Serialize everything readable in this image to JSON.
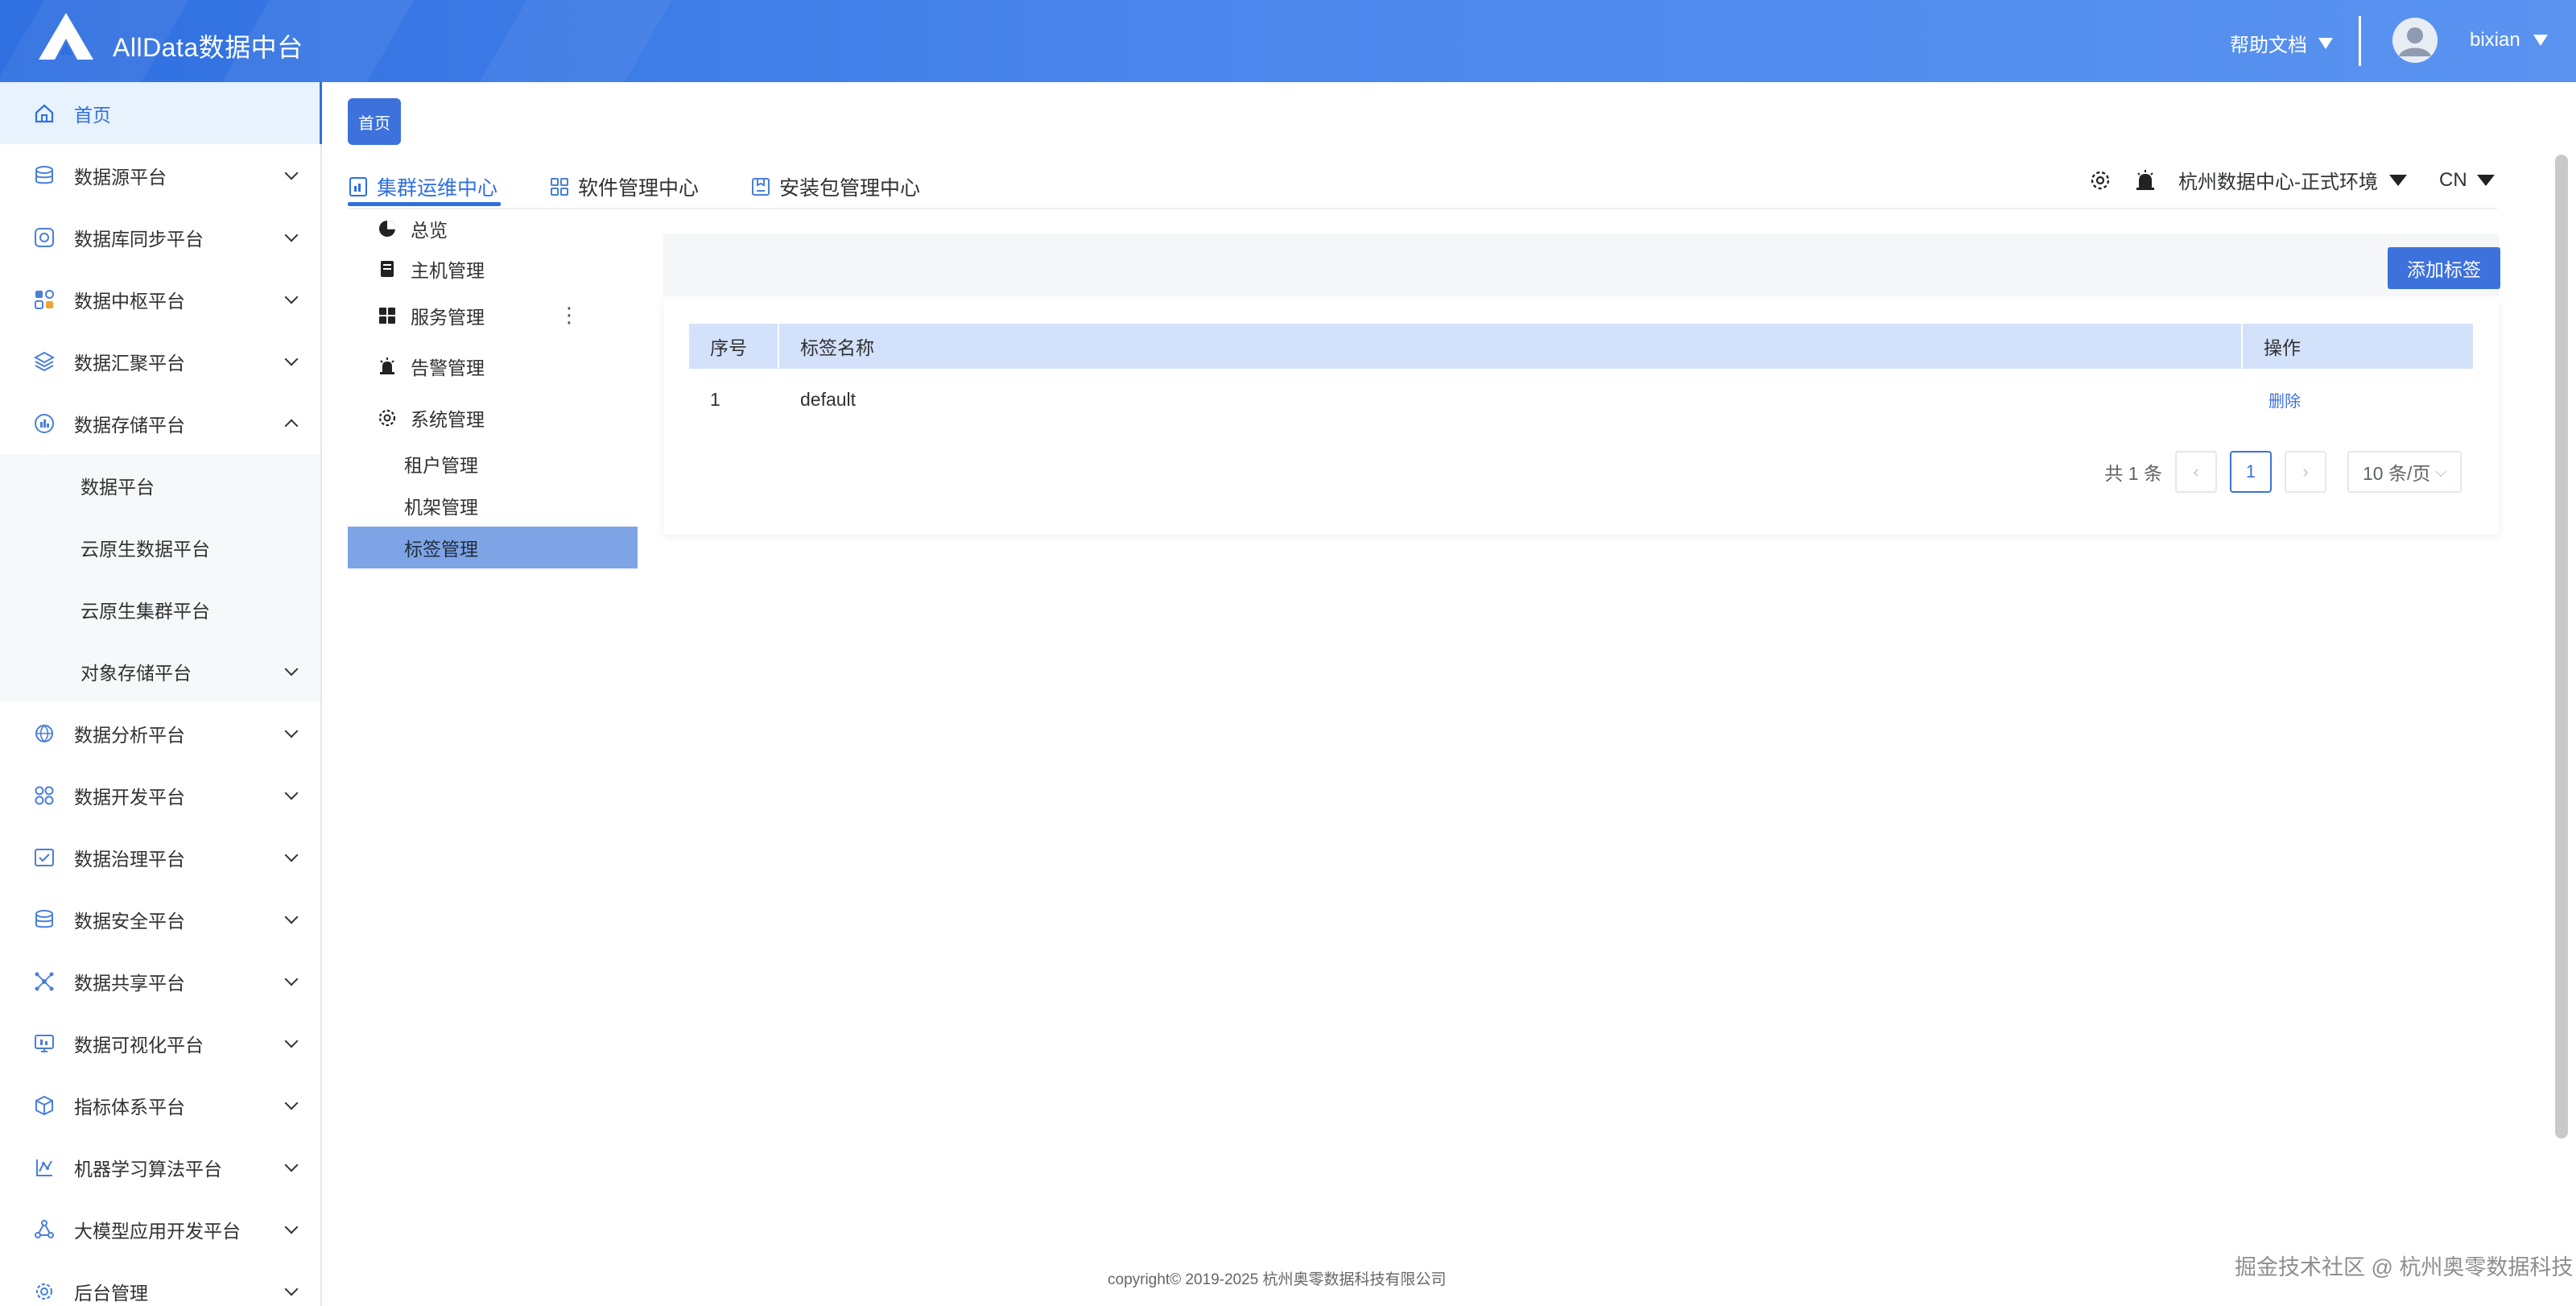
{
  "header": {
    "app_title": "AllData数据中台",
    "help_label": "帮助文档",
    "username": "bixian"
  },
  "sidebar": {
    "items": [
      {
        "label": "首页",
        "icon": "home-icon",
        "active": true
      },
      {
        "label": "数据源平台",
        "icon": "database-icon"
      },
      {
        "label": "数据库同步平台",
        "icon": "sync-icon"
      },
      {
        "label": "数据中枢平台",
        "icon": "hub-icon"
      },
      {
        "label": "数据汇聚平台",
        "icon": "layers-icon"
      },
      {
        "label": "数据存储平台",
        "icon": "storage-icon",
        "expanded": true
      }
    ],
    "storage_children": [
      "数据平台",
      "云原生数据平台",
      "云原生集群平台",
      "对象存储平台"
    ],
    "items_after": [
      {
        "label": "数据分析平台",
        "icon": "analysis-icon"
      },
      {
        "label": "数据开发平台",
        "icon": "develop-icon"
      },
      {
        "label": "数据治理平台",
        "icon": "governance-icon"
      },
      {
        "label": "数据安全平台",
        "icon": "security-icon"
      },
      {
        "label": "数据共享平台",
        "icon": "share-icon"
      },
      {
        "label": "数据可视化平台",
        "icon": "visualization-icon"
      },
      {
        "label": "指标体系平台",
        "icon": "metrics-icon"
      },
      {
        "label": "机器学习算法平台",
        "icon": "ml-icon"
      },
      {
        "label": "大模型应用开发平台",
        "icon": "llm-icon"
      },
      {
        "label": "后台管理",
        "icon": "admin-icon"
      }
    ]
  },
  "breadcrumb_tag": "首页",
  "tabs": [
    {
      "label": "集群运维中心",
      "active": true
    },
    {
      "label": "软件管理中心"
    },
    {
      "label": "安装包管理中心"
    }
  ],
  "toolbar": {
    "environment": "杭州数据中心-正式环境",
    "language": "CN"
  },
  "submenu": {
    "overview": "总览",
    "host": "主机管理",
    "service": "服务管理",
    "alert": "告警管理",
    "system": "系统管理",
    "system_children": [
      "租户管理",
      "机架管理",
      "标签管理"
    ]
  },
  "content": {
    "add_button": "添加标签",
    "columns": [
      "序号",
      "标签名称",
      "操作"
    ],
    "rows": [
      {
        "index": "1",
        "name": "default",
        "action": "删除"
      }
    ],
    "pagination": {
      "total_text": "共 1 条",
      "current_page": "1",
      "page_size": "10 条/页"
    }
  },
  "footer": "copyright© 2019-2025 杭州奥零数据科技有限公司",
  "watermark": "掘金技术社区 @ 杭州奥零数据科技",
  "colors": {
    "primary": "#3d72dc",
    "header_start": "#2f6fe0",
    "header_end": "#5a93f0",
    "table_header": "#d3e1fa",
    "submenu_active": "#7ea4e6"
  }
}
